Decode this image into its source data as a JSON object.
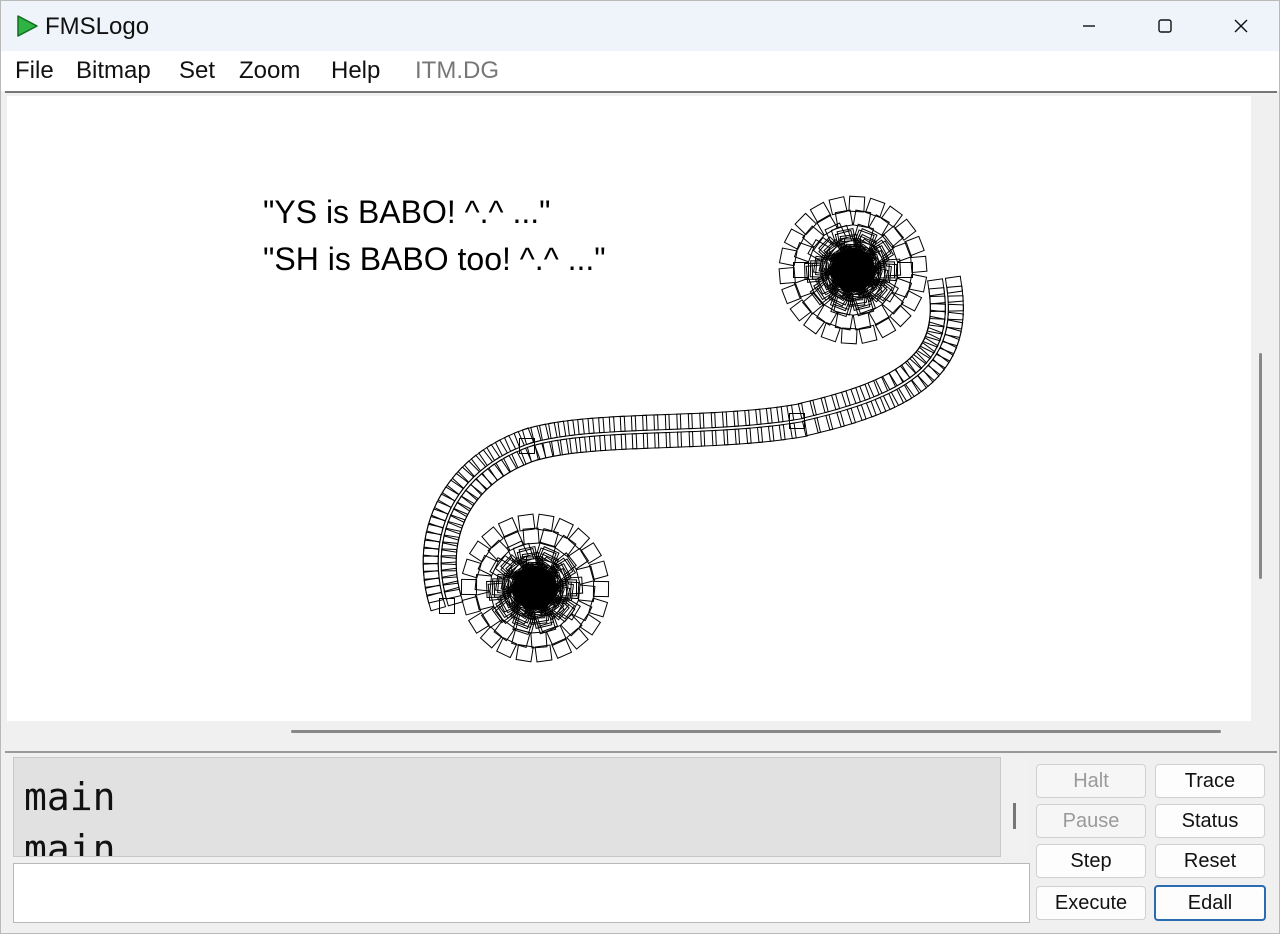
{
  "window": {
    "title": "FMSLogo",
    "controls": [
      "minimize-icon",
      "maximize-icon",
      "close-icon"
    ]
  },
  "menu": {
    "file": "File",
    "bitmap": "Bitmap",
    "set": "Set",
    "zoom": "Zoom",
    "help": "Help",
    "status": "ITM.DG"
  },
  "canvas": {
    "line1": "\"YS is BABO! ^.^ ...\"",
    "line2": "\"SH is BABO too! ^.^ ...\""
  },
  "history": {
    "line1": "main",
    "line2": "main"
  },
  "command": {
    "value": ""
  },
  "buttons": {
    "halt": "Halt",
    "trace": "Trace",
    "pause": "Pause",
    "status": "Status",
    "step": "Step",
    "reset": "Reset",
    "execute": "Execute",
    "edall": "Edall"
  },
  "colors": {
    "accent_green": "#2fb344",
    "focus_blue": "#2b6cb0"
  }
}
